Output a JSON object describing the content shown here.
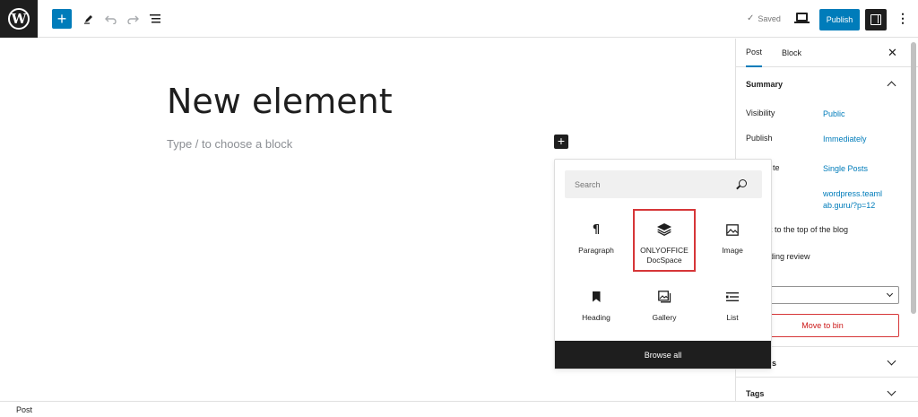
{
  "toolbar": {
    "add_block_label": "+",
    "saved_label": "Saved",
    "publish_label": "Publish"
  },
  "editor": {
    "post_title": "New element",
    "block_placeholder": "Type / to choose a block"
  },
  "inserter": {
    "search_placeholder": "Search",
    "blocks": [
      {
        "label": "Paragraph",
        "icon": "paragraph-icon"
      },
      {
        "label": "ONLYOFFICE DocSpace",
        "icon": "layers-icon",
        "highlighted": true
      },
      {
        "label": "Image",
        "icon": "image-icon"
      },
      {
        "label": "Heading",
        "icon": "bookmark-icon"
      },
      {
        "label": "Gallery",
        "icon": "gallery-icon"
      },
      {
        "label": "List",
        "icon": "list-icon"
      }
    ],
    "browse_all_label": "Browse all"
  },
  "sidebar": {
    "tabs": [
      {
        "label": "Post",
        "active": true
      },
      {
        "label": "Block",
        "active": false
      }
    ],
    "summary": {
      "title": "Summary",
      "visibility_label": "Visibility",
      "visibility_value": "Public",
      "publish_label": "Publish",
      "publish_value": "Immediately",
      "template_label": "te",
      "template_value": "Single Posts",
      "url_value": "wordpress.teamlab.guru/?p=12",
      "sticky_label": "tick to the top of the blog",
      "pending_label": "ending review",
      "author_label": "t",
      "move_to_bin_label": "Move to bin"
    },
    "categories_label": "ries",
    "tags_label": "Tags"
  },
  "footer": {
    "breadcrumb": "Post"
  },
  "colors": {
    "accent": "#007cba",
    "dark": "#1e1e1e",
    "danger": "#d63638"
  }
}
